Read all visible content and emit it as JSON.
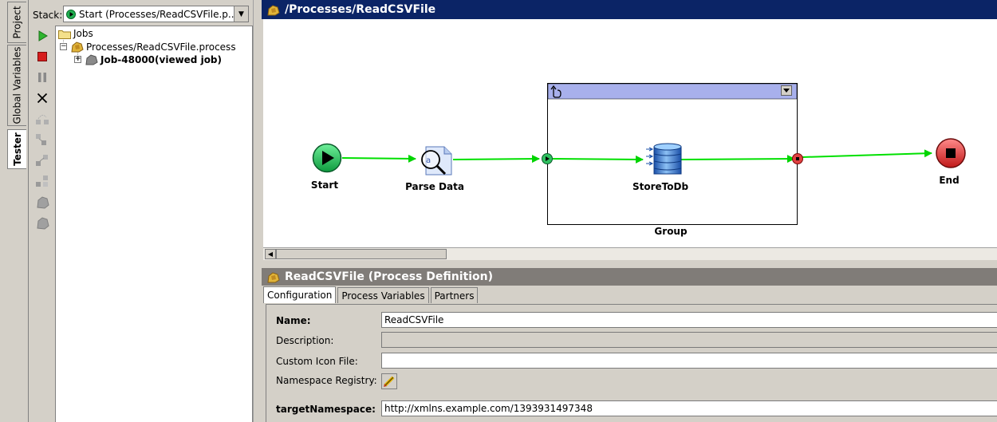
{
  "side_tabs": {
    "project": "Project",
    "global_variables": "Global Variables",
    "tester": "Tester"
  },
  "stack": {
    "label": "Stack:",
    "value": "Start (Processes/ReadCSVFile.p..."
  },
  "tree": {
    "root": "Jobs",
    "process": "Processes/ReadCSVFile.process",
    "job": "Job-48000(viewed job)"
  },
  "canvas": {
    "title": "/Processes/ReadCSVFile",
    "nodes": {
      "start": "Start",
      "parse": "Parse Data",
      "store": "StoreToDb",
      "group": "Group",
      "end": "End"
    }
  },
  "panel": {
    "title": "ReadCSVFile (Process Definition)",
    "tabs": [
      "Configuration",
      "Process Variables",
      "Partners"
    ],
    "fields": {
      "name_label": "Name:",
      "name_value": "ReadCSVFile",
      "description_label": "Description:",
      "custom_icon_label": "Custom Icon File:",
      "namespace_registry_label": "Namespace Registry:",
      "target_ns_label": "targetNamespace:",
      "target_ns_value": "http://xmlns.example.com/1393931497348"
    }
  },
  "colors": {
    "title_bar": "#0b2466",
    "flow": "#00e000",
    "group_header": "#a8b0ec"
  }
}
